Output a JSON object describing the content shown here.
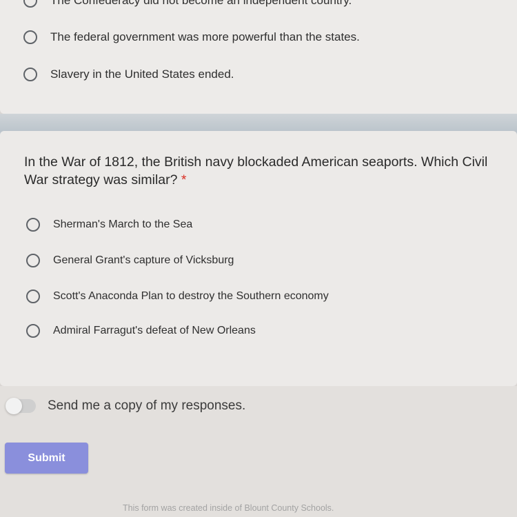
{
  "previous_question": {
    "options": [
      {
        "label": "The Confederacy did not become an independent country."
      },
      {
        "label": "The federal government was more powerful than the states."
      },
      {
        "label": "Slavery in the United States ended."
      }
    ]
  },
  "question": {
    "text": "In the War of 1812, the British navy blockaded American seaports. Which Civil War strategy was similar?",
    "required_marker": "*",
    "options": [
      {
        "label": "Sherman's March to the Sea"
      },
      {
        "label": "General Grant's capture of Vicksburg"
      },
      {
        "label": "Scott's Anaconda Plan to destroy the Southern economy"
      },
      {
        "label": "Admiral Farragut's defeat of New Orleans"
      }
    ]
  },
  "copy_toggle": {
    "label": "Send me a copy of my responses.",
    "checked": false
  },
  "submit_label": "Submit",
  "footer_text": "This form was created inside of Blount County Schools.",
  "colors": {
    "accent": "#8a8fdc",
    "required": "#d93025"
  }
}
